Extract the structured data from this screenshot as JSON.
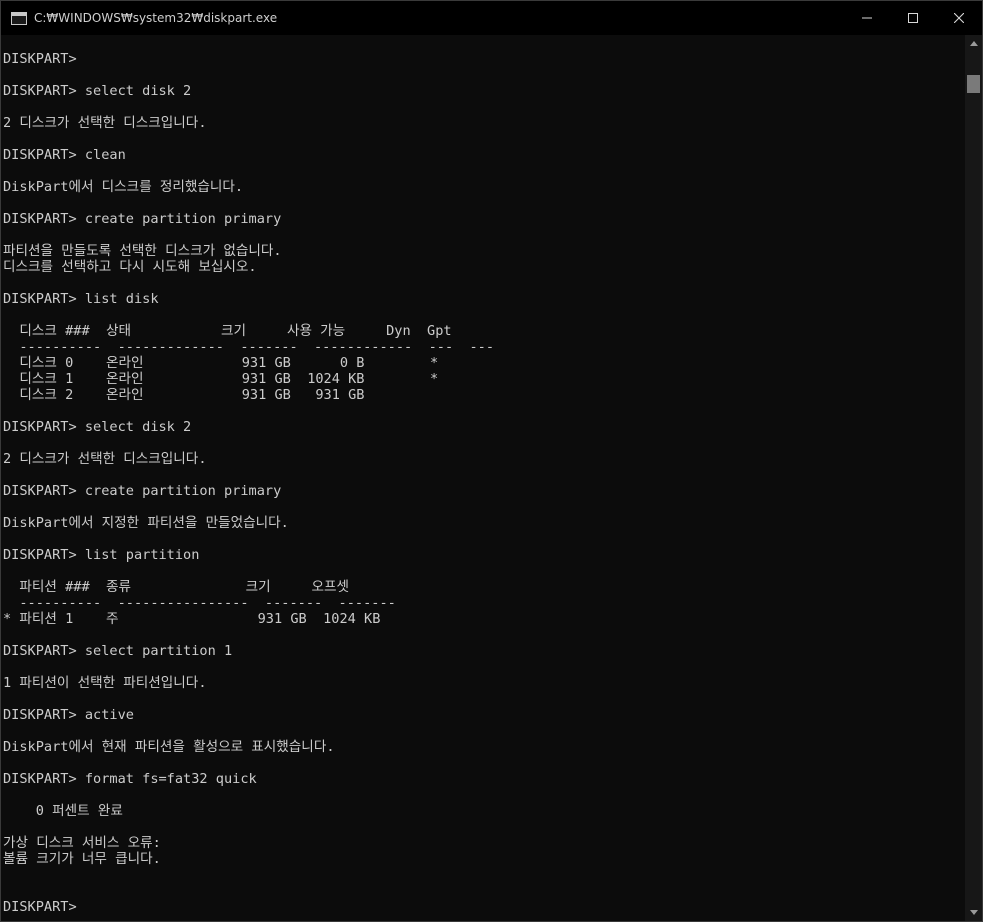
{
  "window": {
    "title": "C:₩WINDOWS₩system32₩diskpart.exe",
    "controls": {
      "minimize": "minimize-icon",
      "maximize": "maximize-icon",
      "close": "close-icon"
    }
  },
  "console": {
    "text_color": "#cccccc",
    "background": "#0c0c0c",
    "lines": [
      "DISKPART>",
      "DISKPART> select disk 2",
      "2 디스크가 선택한 디스크입니다.",
      "DISKPART> clean",
      "DiskPart에서 디스크를 정리했습니다.",
      "DISKPART> create partition primary",
      "파티션을 만들도록 선택한 디스크가 없습니다.",
      "디스크를 선택하고 다시 시도해 보십시오.",
      "DISKPART> list disk",
      "  디스크 ###  상태           크기     사용 가능     Dyn  Gpt",
      "  ----------  -------------  -------  ------------  ---  ---",
      "  디스크 0    온라인            931 GB      0 B        *",
      "  디스크 1    온라인            931 GB  1024 KB        *",
      "  디스크 2    온라인            931 GB   931 GB",
      "DISKPART> select disk 2",
      "2 디스크가 선택한 디스크입니다.",
      "DISKPART> create partition primary",
      "DiskPart에서 지정한 파티션을 만들었습니다.",
      "DISKPART> list partition",
      "  파티션 ###  종류              크기     오프셋",
      "  ----------  ----------------  -------  -------",
      "* 파티션 1    주                 931 GB  1024 KB",
      "DISKPART> select partition 1",
      "1 파티션이 선택한 파티션입니다.",
      "DISKPART> active",
      "DiskPart에서 현재 파티션을 활성으로 표시했습니다.",
      "DISKPART> format fs=fat32 quick",
      "    0 퍼센트 완료",
      "가상 디스크 서비스 오류:",
      "볼륨 크기가 너무 큽니다.",
      "DISKPART>"
    ]
  },
  "scrollbar": {
    "up_icon": "scroll-up-icon",
    "down_icon": "scroll-down-icon"
  }
}
